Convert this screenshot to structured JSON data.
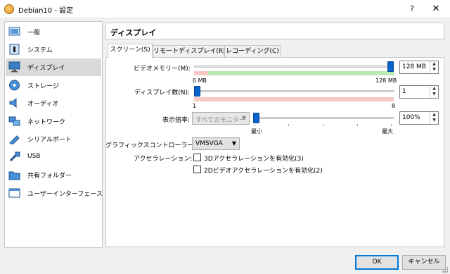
{
  "window": {
    "title": "Debian10 - 設定",
    "help": "?",
    "close": "✕"
  },
  "sidebar": {
    "items": [
      {
        "label": "一般",
        "icon": "general-icon"
      },
      {
        "label": "システム",
        "icon": "system-icon"
      },
      {
        "label": "ディスプレイ",
        "icon": "display-icon",
        "selected": true
      },
      {
        "label": "ストレージ",
        "icon": "storage-icon"
      },
      {
        "label": "オーディオ",
        "icon": "audio-icon"
      },
      {
        "label": "ネットワーク",
        "icon": "network-icon"
      },
      {
        "label": "シリアルポート",
        "icon": "serial-port-icon"
      },
      {
        "label": "USB",
        "icon": "usb-icon"
      },
      {
        "label": "共有フォルダー",
        "icon": "shared-folder-icon"
      },
      {
        "label": "ユーザーインターフェース",
        "icon": "user-interface-icon"
      }
    ]
  },
  "page": {
    "title": "ディスプレイ"
  },
  "tabs": [
    {
      "label": "スクリーン(S)",
      "active": true
    },
    {
      "label": "リモートディスプレイ(R)"
    },
    {
      "label": "レコーディング(C)"
    }
  ],
  "screen": {
    "video_memory": {
      "label": "ビデオメモリー(M):",
      "value": "128 MB",
      "min_label": "0 MB",
      "max_label": "128 MB",
      "fraction": 1.0
    },
    "monitor_count": {
      "label": "ディスプレイ数(N):",
      "value": "1",
      "min_label": "1",
      "max_label": "8",
      "fraction": 0.0
    },
    "scale_factor": {
      "label": "表示倍率:",
      "monitor_select": "すべてのモニター",
      "value": "100%",
      "min_label": "最小",
      "max_label": "最大",
      "fraction": 0.0
    },
    "graphics_controller": {
      "label": "グラフィックスコントローラー(G):",
      "value": "VMSVGA"
    },
    "acceleration": {
      "label": "アクセラレーション:",
      "options": [
        {
          "label": "3Dアクセラレーションを有効化(3)",
          "checked": false
        },
        {
          "label": "2Dビデオアクセラレーションを有効化(2)",
          "checked": false
        }
      ]
    }
  },
  "buttons": {
    "ok": "OK",
    "cancel": "キャンセル"
  }
}
